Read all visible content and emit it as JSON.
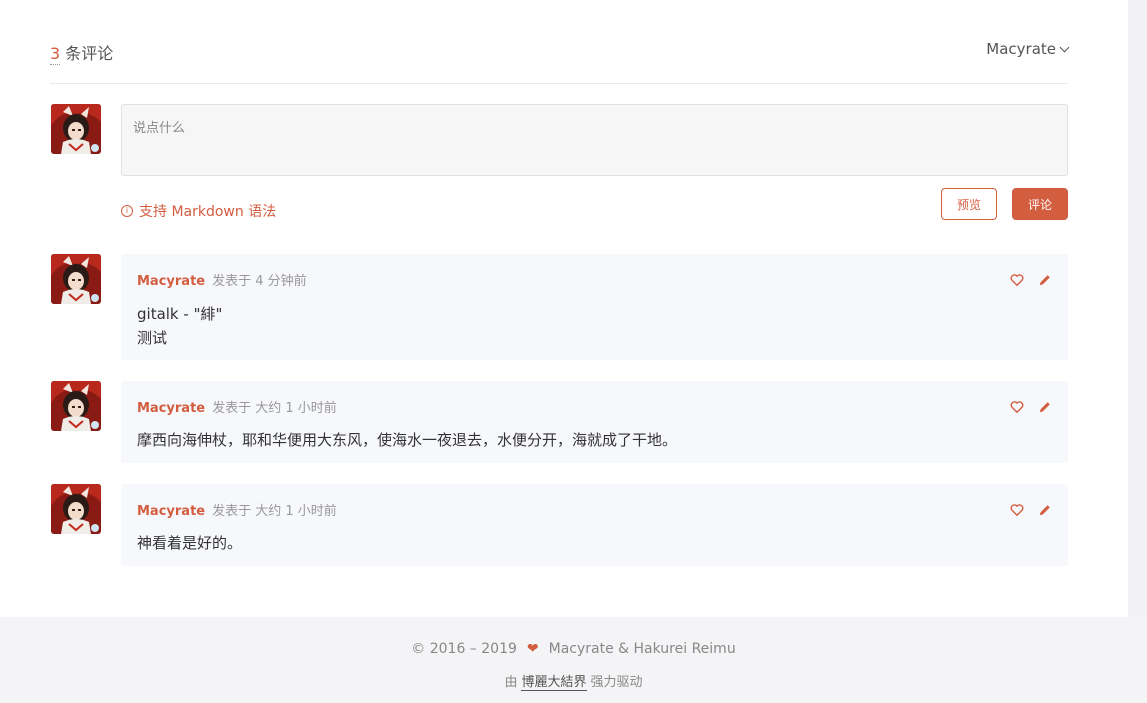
{
  "header": {
    "count": "3",
    "count_suffix": " 条评论",
    "user": "Macyrate"
  },
  "editor": {
    "placeholder": "说点什么",
    "markdown_tip": "支持 Markdown 语法",
    "preview_label": "预览",
    "submit_label": "评论"
  },
  "comments": [
    {
      "author": "Macyrate",
      "meta": "发表于  4 分钟前",
      "lines": [
        "gitalk - \"緋\"",
        "测试"
      ]
    },
    {
      "author": "Macyrate",
      "meta": "发表于  大约 1 小时前",
      "lines": [
        "摩西向海伸杖，耶和华便用大东风，使海水一夜退去，水便分开，海就成了干地。"
      ]
    },
    {
      "author": "Macyrate",
      "meta": "发表于  大约 1 小时前",
      "lines": [
        "神看着是好的。"
      ]
    }
  ],
  "footer": {
    "copyright": "© 2016 – 2019",
    "owners": "Macyrate & Hakurei Reimu",
    "powered_prefix": "由",
    "powered_link": "博麗大結界",
    "powered_suffix": "强力驱动"
  },
  "colors": {
    "accent": "#d35d3f",
    "comment_bg": "#f7f8fb"
  },
  "icons": {
    "like": "heart-outline-icon",
    "edit": "pencil-icon",
    "footer": "heart-icon"
  }
}
